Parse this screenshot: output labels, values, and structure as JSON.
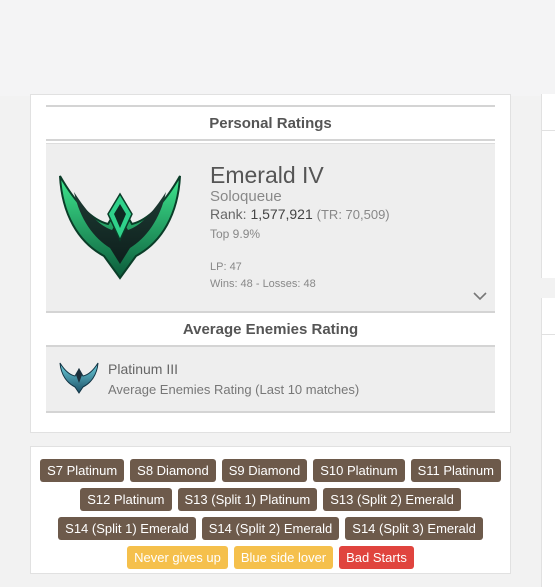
{
  "personal_ratings": {
    "title": "Personal Ratings",
    "rank": {
      "name": "Emerald IV",
      "queue": "Soloqueue",
      "rank_label": "Rank:",
      "rank_value": "1,577,921",
      "tr": "(TR: 70,509)",
      "top": "Top 9.9%",
      "lp": "LP: 47",
      "wins_losses": "Wins: 48 - Losses: 48",
      "emblem_icon": "emerald-emblem-icon"
    },
    "expand_icon": "chevron-down-icon"
  },
  "average_enemies": {
    "title": "Average Enemies Rating",
    "rank_name": "Platinum III",
    "description": "Average Enemies Rating (Last 10 matches)",
    "emblem_icon": "platinum-emblem-icon"
  },
  "tags": [
    {
      "label": "S7 Platinum",
      "kind": "history"
    },
    {
      "label": "S8 Diamond",
      "kind": "history"
    },
    {
      "label": "S9 Diamond",
      "kind": "history"
    },
    {
      "label": "S10 Platinum",
      "kind": "history"
    },
    {
      "label": "S11 Platinum",
      "kind": "history"
    },
    {
      "label": "S12 Platinum",
      "kind": "history"
    },
    {
      "label": "S13 (Split 1) Platinum",
      "kind": "history"
    },
    {
      "label": "S13 (Split 2) Emerald",
      "kind": "history"
    },
    {
      "label": "S14 (Split 1) Emerald",
      "kind": "history"
    },
    {
      "label": "S14 (Split 2) Emerald",
      "kind": "history"
    },
    {
      "label": "S14 (Split 3) Emerald",
      "kind": "history"
    },
    {
      "label": "Never gives up",
      "kind": "positive"
    },
    {
      "label": "Blue side lover",
      "kind": "positive"
    },
    {
      "label": "Bad Starts",
      "kind": "negative"
    }
  ],
  "colors": {
    "history_tag": "#6d5a4b",
    "positive_tag": "#f5c04c",
    "negative_tag": "#e0443e"
  }
}
